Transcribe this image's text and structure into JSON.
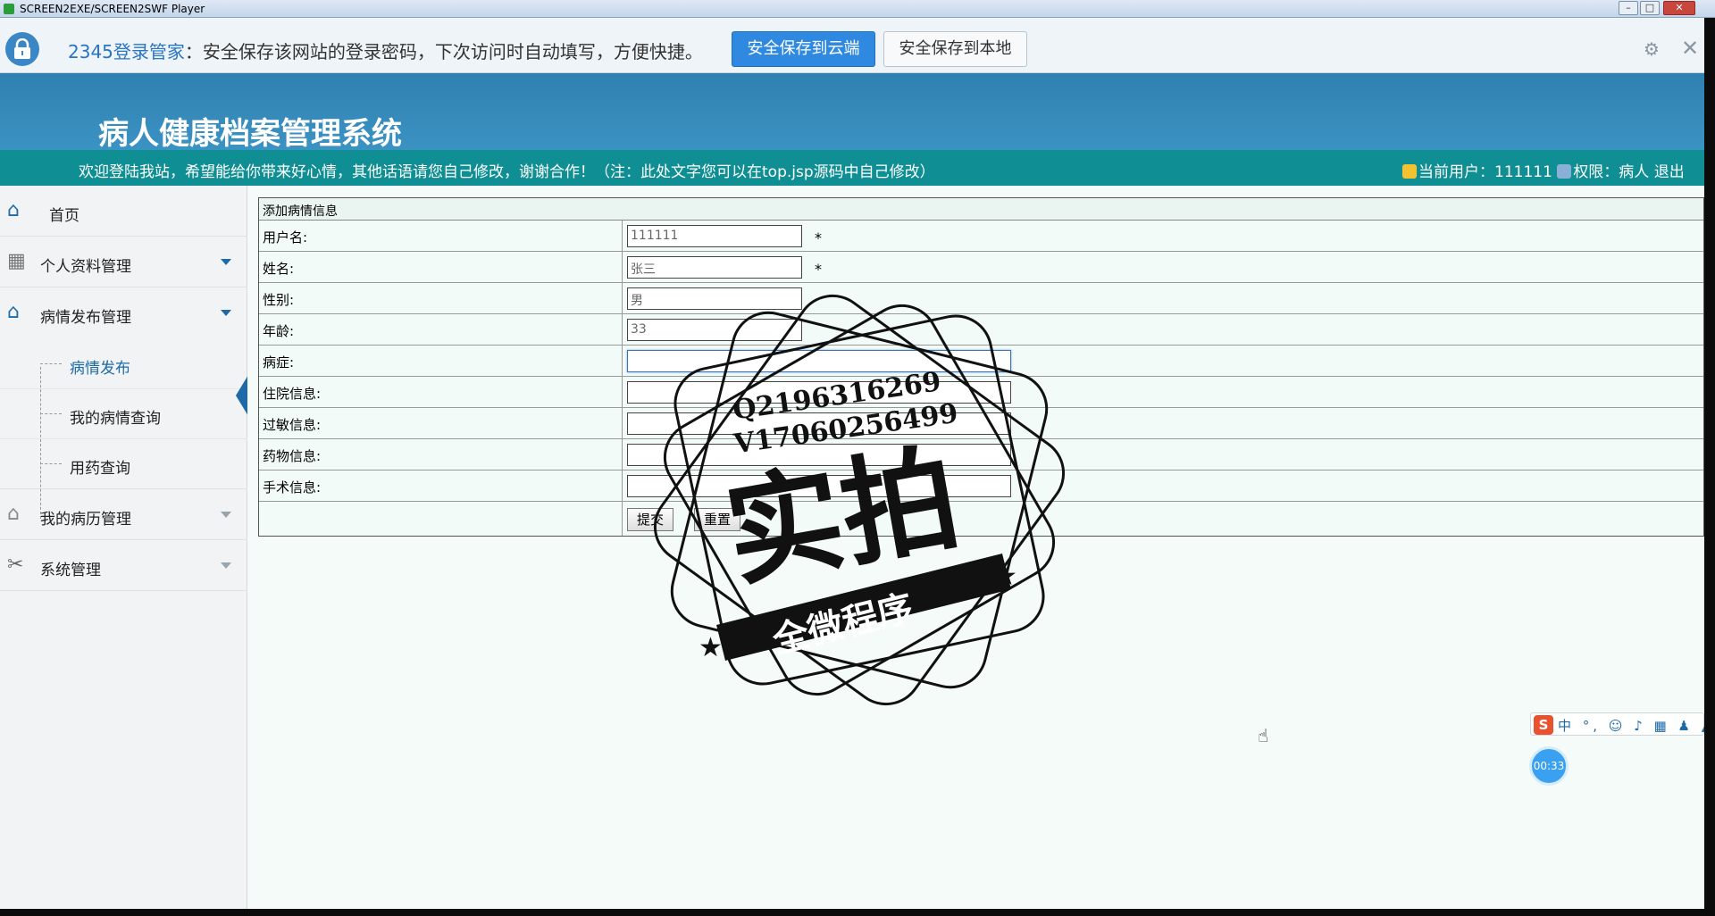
{
  "player": {
    "title": "SCREEN2EXE/SCREEN2SWF Player",
    "minimize": "–",
    "maximize": "□",
    "close": "✕"
  },
  "password_bar": {
    "brand": "2345登录管家",
    "message": "：安全保存该网站的登录密码，下次访问时自动填写，方便快捷。",
    "btn_cloud": "安全保存到云端",
    "btn_local": "安全保存到本地",
    "settings_icon": "⚙",
    "close_icon": "✕"
  },
  "header": {
    "title": "病人健康档案管理系统"
  },
  "welcome": {
    "message": "欢迎登陆我站，希望能给你带来好心情，其他话语请您自己修改，谢谢合作！（注：此处文字您可以在top.jsp源码中自己修改）",
    "current_user": "当前用户：111111",
    "role": "权限：病人",
    "logout": "退出"
  },
  "sidebar": {
    "items": [
      {
        "label": "首页",
        "icon": "home-icon",
        "glyph": "⌂"
      },
      {
        "label": "个人资料管理",
        "icon": "grid-icon",
        "glyph": "▦"
      },
      {
        "label": "病情发布管理",
        "icon": "home-icon",
        "glyph": "⌂"
      },
      {
        "label": "我的病历管理",
        "icon": "home-icon",
        "glyph": "⌂"
      },
      {
        "label": "系统管理",
        "icon": "tools-icon",
        "glyph": "✂"
      }
    ],
    "subitems": [
      {
        "label": "病情发布"
      },
      {
        "label": "我的病情查询"
      },
      {
        "label": "用药查询"
      }
    ]
  },
  "form": {
    "caption": "添加病情信息",
    "fields": [
      {
        "label": "用户名:",
        "value": "111111",
        "required": "*"
      },
      {
        "label": "姓名:",
        "value": "张三",
        "required": "*"
      },
      {
        "label": "性别:",
        "value": "男"
      },
      {
        "label": "年龄:",
        "value": "33"
      },
      {
        "label": "病症:",
        "value": ""
      },
      {
        "label": "住院信息:",
        "value": ""
      },
      {
        "label": "过敏信息:",
        "value": ""
      },
      {
        "label": "药物信息:",
        "value": ""
      },
      {
        "label": "手术信息:",
        "value": ""
      }
    ],
    "submit": "提交",
    "reset": "重置"
  },
  "watermark": {
    "line1": "Q2196316269",
    "line2": "V17060256499",
    "big": "实拍",
    "banner": "全微程序"
  },
  "ime": {
    "logo": "S",
    "text": "中 °, ☺ ♪ ▦ ♟ ▲ ▪"
  },
  "timer": "00:33",
  "colors": {
    "header_blue": "#2f80b0",
    "welcome_teal": "#0f8f93",
    "accent_blue": "#1d6aa8",
    "cloud_button": "#3089e0"
  }
}
